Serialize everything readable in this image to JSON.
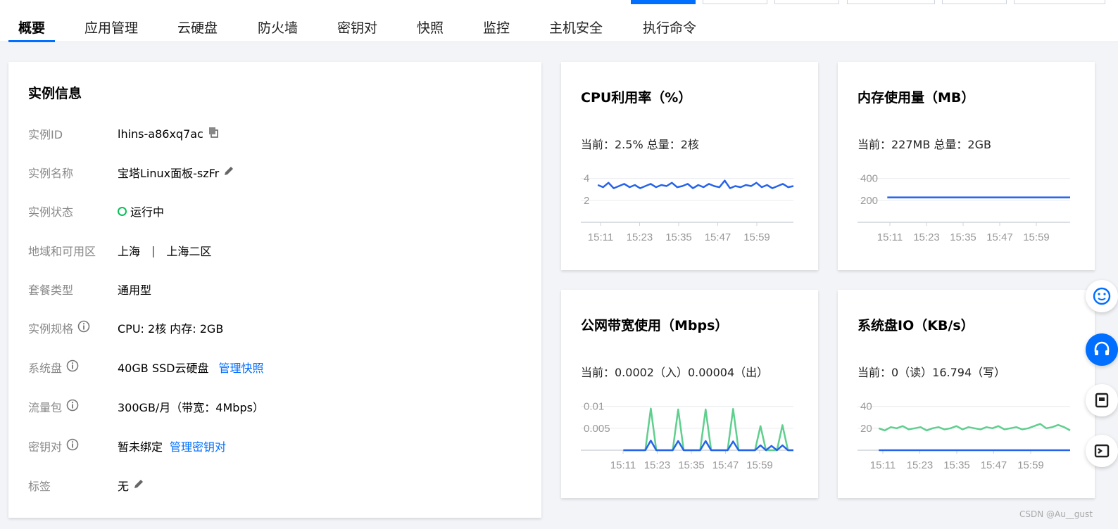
{
  "tabs": [
    {
      "label": "概要",
      "active": true
    },
    {
      "label": "应用管理"
    },
    {
      "label": "云硬盘"
    },
    {
      "label": "防火墙"
    },
    {
      "label": "密钥对"
    },
    {
      "label": "快照"
    },
    {
      "label": "监控"
    },
    {
      "label": "主机安全"
    },
    {
      "label": "执行命令"
    }
  ],
  "instance": {
    "title": "实例信息",
    "rows": [
      {
        "label": "实例ID",
        "value": "lhins-a86xq7ac"
      },
      {
        "label": "实例名称",
        "value": "宝塔Linux面板-szFr"
      },
      {
        "label": "实例状态",
        "value": "运行中"
      },
      {
        "label": "地域和可用区",
        "value": "上海",
        "sep": "|",
        "value2": "上海二区"
      },
      {
        "label": "套餐类型",
        "value": "通用型"
      },
      {
        "label": "实例规格",
        "value": "CPU: 2核 内存: 2GB"
      },
      {
        "label": "系统盘",
        "value": "40GB SSD云硬盘",
        "link": "管理快照"
      },
      {
        "label": "流量包",
        "value": "300GB/月（带宽：4Mbps）"
      },
      {
        "label": "密钥对",
        "value": "暂未绑定",
        "link": "管理密钥对"
      },
      {
        "label": "标签",
        "value": "无"
      }
    ]
  },
  "charts": {
    "cpu": {
      "title": "CPU利用率（%）",
      "current": "当前：2.5% 总量：2核"
    },
    "mem": {
      "title": "内存使用量（MB）",
      "current": "当前：227MB 总量：2GB"
    },
    "bw": {
      "title": "公网带宽使用（Mbps）",
      "current": "当前：0.0002（入）0.00004（出）"
    },
    "io": {
      "title": "系统盘IO（KB/s）",
      "current": "当前：0（读）16.794（写）"
    }
  },
  "chart_data": [
    {
      "type": "line",
      "name": "cpu",
      "x_ticks": [
        "15:11",
        "15:23",
        "15:35",
        "15:47",
        "15:59"
      ],
      "y_ticks": [
        "4",
        "2"
      ],
      "ylim": [
        0,
        5
      ],
      "series": [
        {
          "values": [
            3.4,
            3.2,
            3.6,
            3.1,
            3.3,
            3.5,
            3.2,
            3.4,
            3.1,
            3.3,
            3.5,
            3.2,
            3.4,
            3.3,
            3.6,
            3.2,
            3.3,
            3.5,
            3.1,
            3.4,
            3.2,
            3.5,
            3.3,
            3.2,
            3.8,
            3.1,
            3.3,
            3.2,
            3.4,
            3.3,
            3.6,
            3.2,
            3.4,
            3.1,
            3.3,
            3.5,
            3.2,
            3.3
          ]
        }
      ]
    },
    {
      "type": "line",
      "name": "mem",
      "x_ticks": [
        "15:11",
        "15:23",
        "15:35",
        "15:47",
        "15:59"
      ],
      "y_ticks": [
        "400",
        "200"
      ],
      "ylim": [
        0,
        500
      ],
      "series": [
        {
          "values": [
            227,
            227,
            227,
            227,
            227,
            227,
            227,
            227,
            227,
            227,
            227,
            227,
            227,
            227,
            227,
            227,
            227,
            227,
            227,
            227
          ]
        }
      ]
    },
    {
      "type": "line",
      "name": "bw",
      "x_ticks": [
        "15:11",
        "15:23",
        "15:35",
        "15:47",
        "15:59"
      ],
      "y_ticks": [
        "0.01",
        "0.005"
      ],
      "ylim": [
        0,
        0.0125
      ],
      "series": [
        {
          "color": "#5fcf8e",
          "values": [
            0,
            0,
            0,
            0,
            0,
            0.0095,
            0,
            0,
            0,
            0,
            0.0093,
            0,
            0,
            0,
            0,
            0.0093,
            0,
            0,
            0,
            0,
            0.0094,
            0,
            0,
            0,
            0,
            0.0055,
            0,
            0,
            0,
            0.0057,
            0,
            0
          ]
        },
        {
          "color": "#2563eb",
          "values": [
            0,
            0,
            0,
            0,
            0,
            0.0022,
            0,
            0,
            0,
            0,
            0.0021,
            0,
            0,
            0,
            0,
            0.0021,
            0,
            0,
            0,
            0,
            0.002,
            0,
            0,
            0,
            0,
            0.0011,
            0,
            0.001,
            0,
            0.0011,
            0,
            0
          ]
        }
      ]
    },
    {
      "type": "line",
      "name": "io",
      "x_ticks": [
        "15:11",
        "15:23",
        "15:35",
        "15:47",
        "15:59"
      ],
      "y_ticks": [
        "40",
        "20"
      ],
      "ylim": [
        0,
        50
      ],
      "series": [
        {
          "color": "#5fcf8e",
          "values": [
            20,
            18,
            21,
            20,
            22,
            19,
            20,
            21,
            18,
            20,
            21,
            19,
            20,
            22,
            19,
            21,
            20,
            19,
            21,
            20,
            22,
            19,
            20,
            21,
            19,
            20,
            22,
            24,
            20,
            21,
            23,
            21,
            18
          ]
        },
        {
          "color": "#2563eb",
          "values": [
            0,
            0,
            0,
            0,
            0,
            0,
            0,
            0,
            0,
            0,
            0,
            0,
            0,
            0,
            0,
            0,
            0,
            0,
            0,
            0,
            0,
            0,
            0,
            0,
            0,
            0,
            0,
            0,
            0,
            0,
            0,
            0,
            0
          ]
        }
      ]
    }
  ],
  "watermark": "CSDN @Au__gust",
  "colors": {
    "accent": "#006eff",
    "running": "#0abf5b",
    "cpu_line": "#2563eb",
    "green_line": "#5fcf8e"
  }
}
